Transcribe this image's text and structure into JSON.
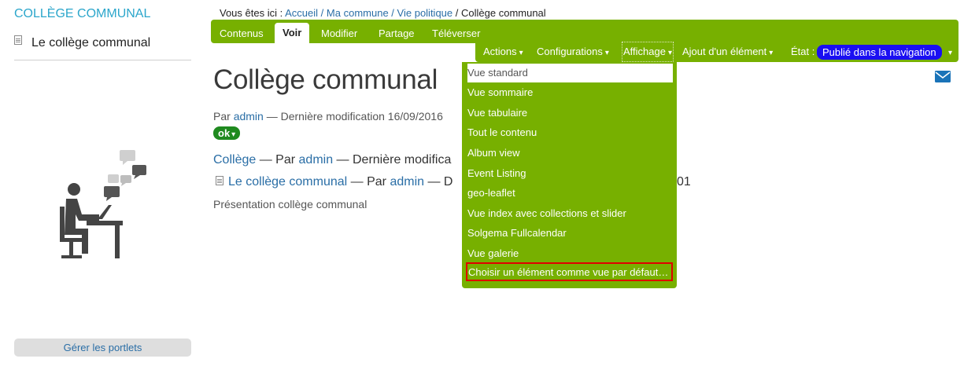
{
  "sidebar": {
    "title": "COLLÈGE COMMUNAL",
    "item_label": "Le collège communal",
    "manage_label": "Gérer les portlets"
  },
  "breadcrumb": {
    "prefix": "Vous êtes ici :",
    "items": [
      "Accueil",
      "Ma commune",
      "Vie politique"
    ],
    "current": "Collège communal",
    "separator": "/"
  },
  "tabs": [
    "Contenus",
    "Voir",
    "Modifier",
    "Partage",
    "Téléverser"
  ],
  "active_tab": "Voir",
  "actions": {
    "items": [
      "Actions",
      "Configurations",
      "Affichage",
      "Ajout d'un élément"
    ],
    "state_label": "État :",
    "state_value": "Publié dans la navigation",
    "caret": "▾"
  },
  "dropdown": {
    "items": [
      "Vue standard",
      "Vue sommaire",
      "Vue tabulaire",
      "Tout le contenu",
      "Album view",
      "Event Listing",
      "geo-leaflet",
      "Vue index avec collections et slider",
      "Solgema Fullcalendar",
      "Vue galerie",
      "Choisir un élément comme vue par défaut…"
    ]
  },
  "main": {
    "title": "Collège communal",
    "byline_prefix": "Par",
    "author": "admin",
    "byline_suffix": "— Dernière modification 16/09/2016",
    "status_badge": "ok",
    "line1_type": "Collège",
    "line1_mid": "— Par",
    "line1_author": "admin",
    "line1_suffix": "— Dernière modifica",
    "line2_link": "Le collège communal",
    "line2_mid": "— Par",
    "line2_author": "admin",
    "line2_suffix": "— D",
    "line2_tail": "01",
    "description": "Présentation collège communal"
  },
  "colors": {
    "green": "#77b000",
    "link": "#2a6ea6",
    "state_blue": "#1a0ff2",
    "highlight_red": "#e00000"
  }
}
